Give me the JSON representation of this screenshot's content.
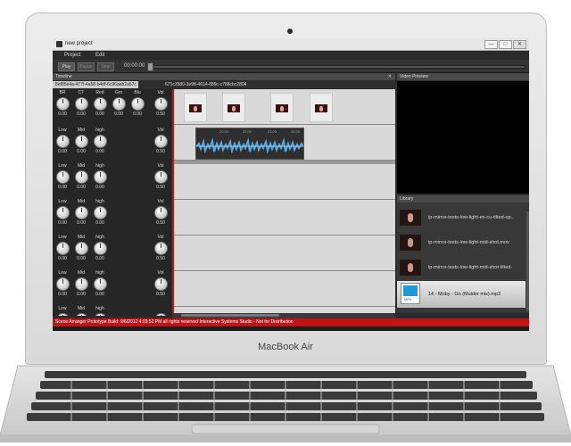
{
  "window": {
    "title": "new project",
    "buttons": [
      "—",
      "□",
      "✕"
    ]
  },
  "menu": {
    "items": [
      "Project",
      "Edit"
    ]
  },
  "transport": {
    "play": "Play",
    "pause": "Pause",
    "stop": "Stop",
    "time": "00:00:00"
  },
  "timeline": {
    "header": "Timeline",
    "tab_active": "8ef85e4a-477f-4a58-b4df-6c96aeb2a57c",
    "tab_other": "671c3580-3e98-4614-889c-c788cbc2804"
  },
  "mixer": {
    "row1": {
      "labels": [
        "BR",
        "CT",
        "Red",
        "Grn",
        "Blu",
        "Vol"
      ],
      "values": [
        "0.00",
        "0.00",
        "0.00",
        "0.00",
        "0.00",
        "0.50"
      ]
    },
    "eq_labels": [
      "Low",
      "Mid",
      "high",
      "Vol"
    ],
    "eq_values": [
      "0.00",
      "0.00",
      "0.00",
      "0.50"
    ],
    "row_last_labels": [
      "Low",
      "Mid",
      "high"
    ]
  },
  "audio_clip": {
    "marks": [
      "20.00",
      "22.00",
      "23.00",
      "24.00"
    ]
  },
  "video_preview": {
    "header": "Video Preview"
  },
  "library": {
    "header": "Library",
    "items": [
      {
        "name": "ip-mirror-tests-low-light-ex-cu-tilted-up..",
        "type": "video"
      },
      {
        "name": "ip-mirror-tests-low-light-mid-shot.mov",
        "type": "video"
      },
      {
        "name": "ip-mirror-tests-low-light-mid-shot-tilted-",
        "type": "video"
      },
      {
        "name": "14 - Moby - Go (Mulder mix).mp3",
        "type": "audio",
        "selected": true
      }
    ]
  },
  "status": {
    "text": "Scene Arranger Prototype Build: 9/6/2012 4:03:52 PM  all rights reserved Interactive Systems Studio - Not for Distribution"
  },
  "device": {
    "brand": "MacBook Air"
  }
}
